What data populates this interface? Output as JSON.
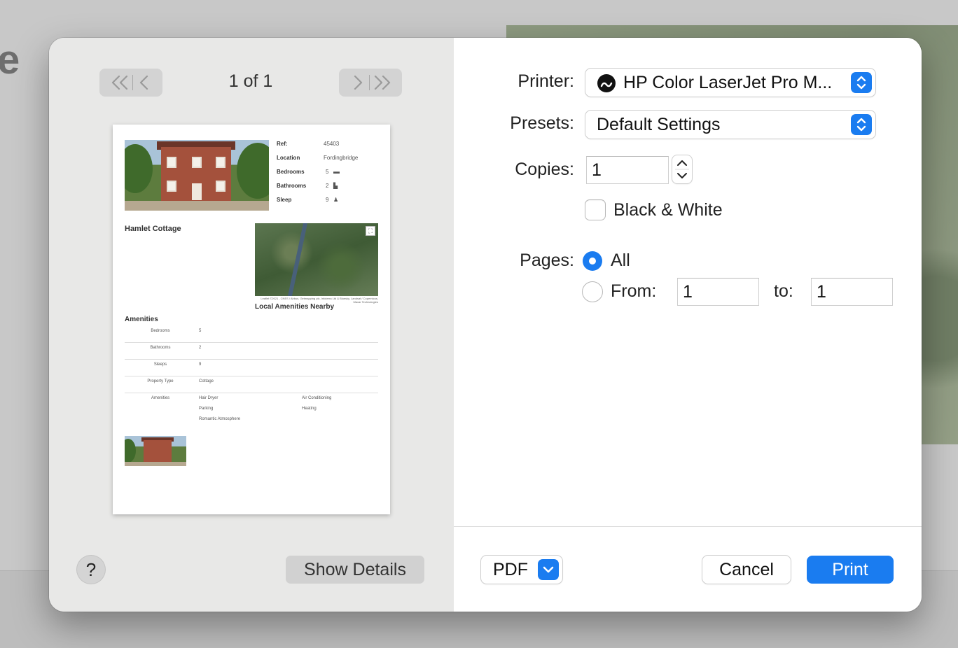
{
  "background": {
    "partial_title": "e"
  },
  "preview": {
    "page_count": "1 of 1",
    "page": {
      "specs": [
        {
          "label": "Ref:",
          "value": "45403"
        },
        {
          "label": "Location",
          "value": "Fordingbridge"
        },
        {
          "label": "Bedrooms",
          "value": "5"
        },
        {
          "label": "Bathrooms",
          "value": "2"
        },
        {
          "label": "Sleep",
          "value": "9"
        }
      ],
      "title": "Hamlet Cottage",
      "map_credit": "Leaflet ©2021 , CNES / Airbus, Getmapping plc, Infoterra Ltd & Bluesky, Landsat / Copernicus, Maxar Technologies",
      "map_caption": "Local Amenities Nearby",
      "amenities_title": "Amenities",
      "table": [
        {
          "key": "Bedrooms",
          "value": "5"
        },
        {
          "key": "Bathrooms",
          "value": "2"
        },
        {
          "key": "Sleeps",
          "value": "9"
        },
        {
          "key": "Property Type",
          "value": "Cottage"
        }
      ],
      "amenities_row": {
        "key": "Amenities",
        "col1": [
          "Hair Dryer",
          "Parking",
          "Romantic Atmosphere"
        ],
        "col2": [
          "Air Conditioning",
          "Heating"
        ]
      }
    },
    "help_label": "?",
    "show_details_label": "Show Details"
  },
  "form": {
    "printer_label": "Printer:",
    "printer_value": "HP Color LaserJet Pro M...",
    "presets_label": "Presets:",
    "presets_value": "Default Settings",
    "copies_label": "Copies:",
    "copies_value": "1",
    "bw_label": "Black & White",
    "pages_label": "Pages:",
    "all_label": "All",
    "from_label": "From:",
    "from_value": "1",
    "to_label": "to:",
    "to_value": "1"
  },
  "footer": {
    "pdf_label": "PDF",
    "cancel_label": "Cancel",
    "print_label": "Print"
  },
  "colors": {
    "accent": "#1a7cf0"
  }
}
